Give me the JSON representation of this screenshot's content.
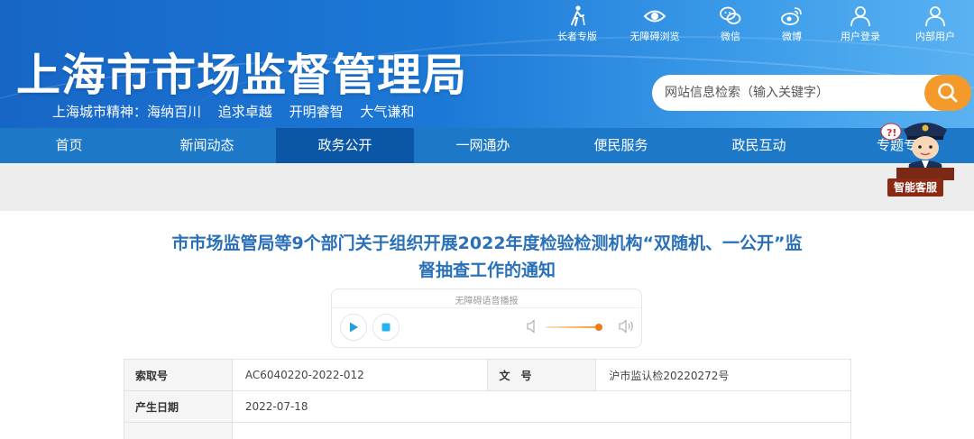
{
  "header": {
    "site_title": "上海市市场监督管理局",
    "slogan": [
      "上海城市精神：海纳百川",
      "追求卓越",
      "开明睿智",
      "大气谦和"
    ],
    "search": {
      "placeholder": "网站信息检索（输入关键字）",
      "icon": "search-icon"
    }
  },
  "top_tools": [
    {
      "label": "长者专版",
      "icon": "elder-icon"
    },
    {
      "label": "无障碍浏览",
      "icon": "eye-icon"
    },
    {
      "label": "微信",
      "icon": "wechat-icon"
    },
    {
      "label": "微博",
      "icon": "weibo-icon"
    },
    {
      "label": "用户登录",
      "icon": "user-icon"
    },
    {
      "label": "内部用户",
      "icon": "user-icon"
    }
  ],
  "nav": {
    "items": [
      "首页",
      "新闻动态",
      "政务公开",
      "一网通办",
      "便民服务",
      "政民互动",
      "专题专"
    ],
    "active_index": 2
  },
  "assistant": {
    "label": "智能客服",
    "icon": "customer-service-icon"
  },
  "article": {
    "title_line1": "市市场监管局等9个部门关于组织开展2022年度检验检测机构“双随机、一公开”监",
    "title_line2": "督抽查工作的通知"
  },
  "audio_player": {
    "title": "无障碍语音播报",
    "volume_level": 0.87
  },
  "meta": {
    "index_label": "索取号",
    "index_value": "AC6040220-2022-012",
    "doc_label": "文　号",
    "doc_value": "沪市监认检20220272号",
    "date_label": "产生日期",
    "date_value": "2022-07-18"
  },
  "colors": {
    "header_blue": "#1c78d6",
    "nav_blue": "#1d79c8",
    "nav_active": "#0b56a5",
    "title_blue": "#2970b8",
    "accent_orange": "#f49a2a"
  }
}
